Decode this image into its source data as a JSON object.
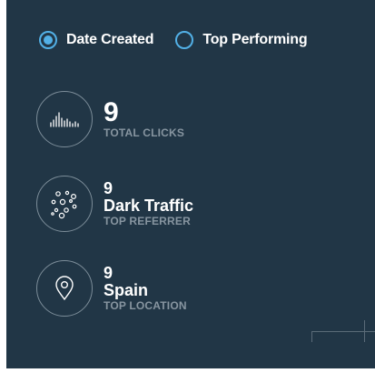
{
  "sort": {
    "options": [
      {
        "label": "Date Created",
        "selected": true
      },
      {
        "label": "Top Performing",
        "selected": false
      }
    ]
  },
  "stats": {
    "clicks": {
      "value": "9",
      "caption": "TOTAL CLICKS",
      "icon": "bar-chart-icon"
    },
    "referrer": {
      "value": "9",
      "name": "Dark Traffic",
      "caption": "TOP REFERRER",
      "icon": "scatter-nodes-icon"
    },
    "location": {
      "value": "9",
      "name": "Spain",
      "caption": "TOP LOCATION",
      "icon": "map-pin-icon"
    }
  },
  "colors": {
    "panel_bg": "#213646",
    "accent": "#52b0e6",
    "caption": "#8795a0"
  }
}
